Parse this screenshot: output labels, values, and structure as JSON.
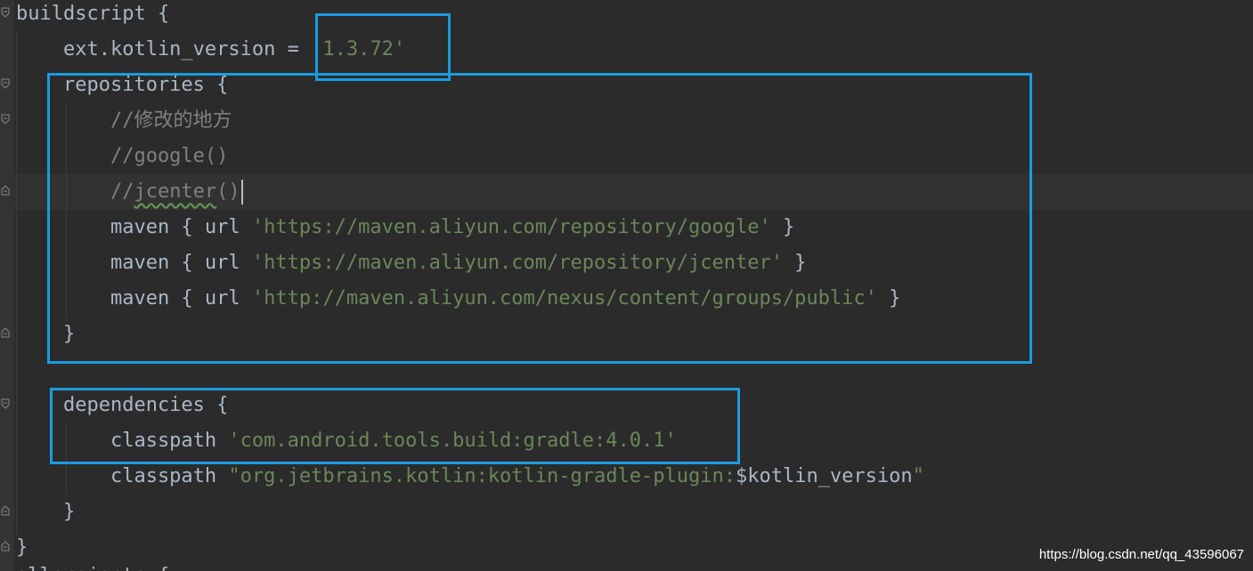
{
  "editor": {
    "lines": [
      {
        "parts": [
          {
            "text": "buildscript {",
            "kind": "plain"
          }
        ]
      },
      {
        "parts": [
          {
            "text": "    ext.kotlin_version = ",
            "kind": "plain"
          },
          {
            "text": "'1.3.72'",
            "kind": "string"
          }
        ]
      },
      {
        "parts": [
          {
            "text": "    repositories {",
            "kind": "plain"
          }
        ]
      },
      {
        "parts": [
          {
            "text": "        //修改的地方",
            "kind": "comment"
          }
        ]
      },
      {
        "parts": [
          {
            "text": "        //google()",
            "kind": "comment"
          }
        ]
      },
      {
        "parts": [
          {
            "text": "        //",
            "kind": "comment"
          },
          {
            "text": "jcenter",
            "kind": "comment-typo"
          },
          {
            "text": "()",
            "kind": "comment"
          }
        ]
      },
      {
        "parts": [
          {
            "text": "        maven { url ",
            "kind": "plain"
          },
          {
            "text": "'https://maven.aliyun.com/repository/google'",
            "kind": "string"
          },
          {
            "text": " }",
            "kind": "plain"
          }
        ]
      },
      {
        "parts": [
          {
            "text": "        maven { url ",
            "kind": "plain"
          },
          {
            "text": "'https://maven.aliyun.com/repository/jcenter'",
            "kind": "string"
          },
          {
            "text": " }",
            "kind": "plain"
          }
        ]
      },
      {
        "parts": [
          {
            "text": "        maven { url ",
            "kind": "plain"
          },
          {
            "text": "'http://maven.aliyun.com/nexus/content/groups/public'",
            "kind": "string"
          },
          {
            "text": " }",
            "kind": "plain"
          }
        ]
      },
      {
        "parts": [
          {
            "text": "    }",
            "kind": "plain"
          }
        ]
      },
      {
        "parts": [
          {
            "text": "",
            "kind": "plain"
          }
        ]
      },
      {
        "parts": [
          {
            "text": "    dependencies {",
            "kind": "plain"
          }
        ]
      },
      {
        "parts": [
          {
            "text": "        classpath ",
            "kind": "plain"
          },
          {
            "text": "'com.android.tools.build:gradle:4.0.1'",
            "kind": "string"
          }
        ]
      },
      {
        "parts": [
          {
            "text": "        classpath ",
            "kind": "plain"
          },
          {
            "text": "\"org.jetbrains.kotlin:kotlin-gradle-plugin:",
            "kind": "string"
          },
          {
            "text": "$kotlin_version",
            "kind": "variable"
          },
          {
            "text": "\"",
            "kind": "string"
          }
        ]
      },
      {
        "parts": [
          {
            "text": "    }",
            "kind": "plain"
          }
        ]
      },
      {
        "parts": [
          {
            "text": "}",
            "kind": "plain"
          }
        ]
      }
    ],
    "partial_next_line": "allprojects {",
    "cursor_line": 6
  },
  "watermark": "https://blog.csdn.net/qq_43596067",
  "colors": {
    "background": "#2b2b2b",
    "text": "#a9b7c6",
    "string": "#6a8759",
    "comment": "#808080",
    "highlight_box": "#1b9be0"
  }
}
